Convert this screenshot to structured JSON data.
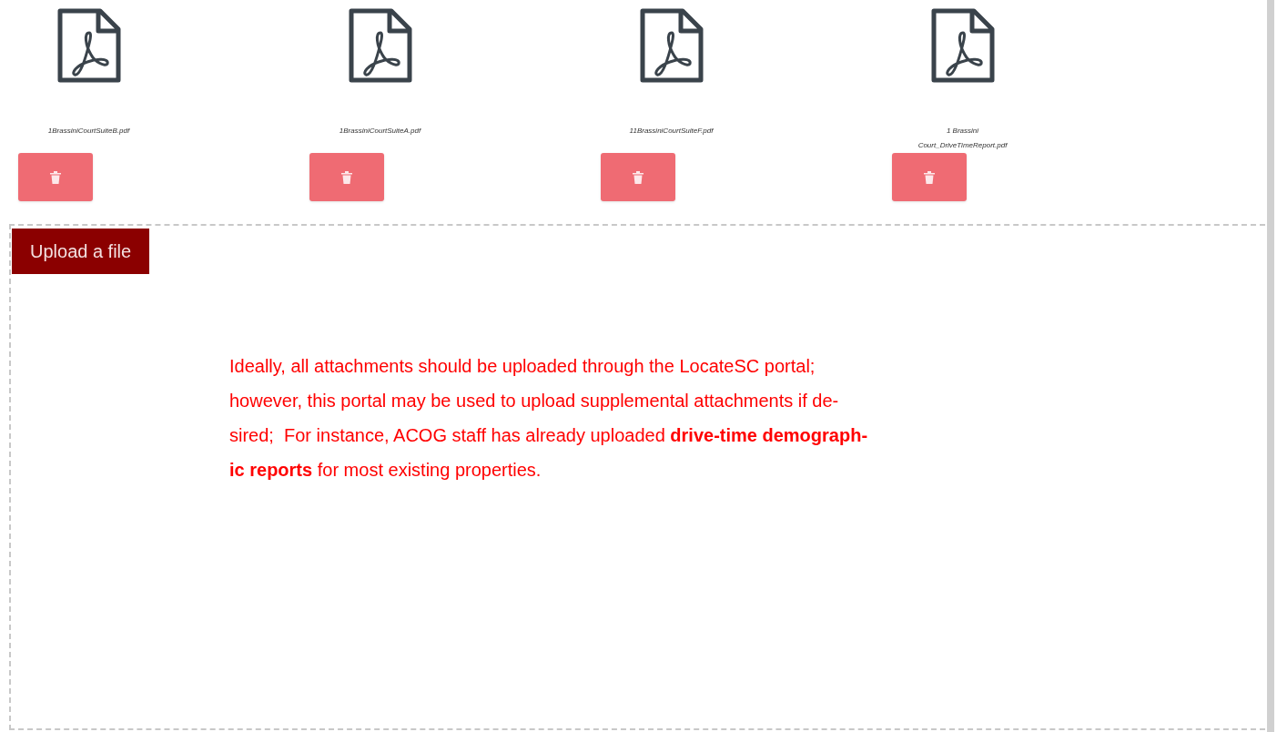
{
  "files": [
    {
      "name_lines": [
        "1BrassiniCourtSuiteB.pdf"
      ]
    },
    {
      "name_lines": [
        "1BrassiniCourtSuiteA.pdf"
      ]
    },
    {
      "name_lines": [
        "11BrassiniCourtSuiteF.pdf"
      ]
    },
    {
      "name_lines": [
        "1 Brassini",
        "Court_DriveTimeReport.pdf"
      ]
    }
  ],
  "upload_button": "Upload a file",
  "notice_lines": [
    "Ideally, all attachments should be uploaded through the LocateSC portal;",
    "however, this portal may be used to upload supplemental attachments if de-",
    "sired;  For instance, ACOG staff has already uploaded **drive-time demograph-**",
    "**ic reports** for most existing properties."
  ]
}
